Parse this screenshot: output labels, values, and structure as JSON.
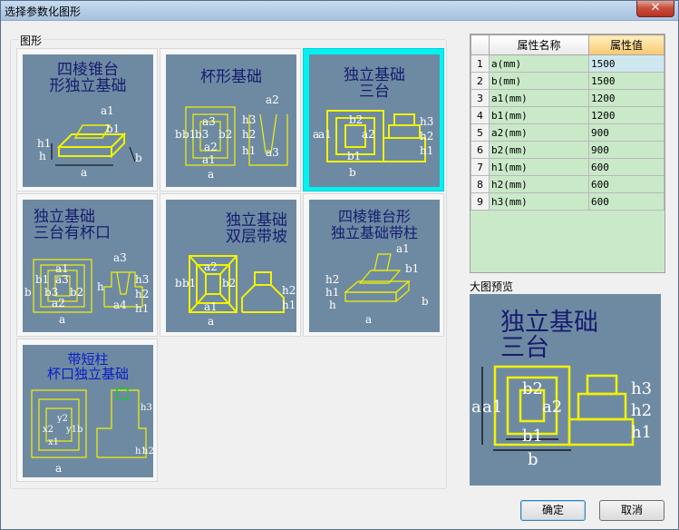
{
  "window": {
    "title": "选择参数化图形",
    "close_glyph": "✕"
  },
  "gallery": {
    "label": "图形",
    "items": [
      {
        "title": "四棱锥台\n形独立基础",
        "labels": [
          "a1",
          "b1",
          "h1",
          "h",
          "a",
          "b"
        ]
      },
      {
        "title": "杯形基础",
        "labels": [
          "a2",
          "b3",
          "h3",
          "a3",
          "b2",
          "h2",
          "b",
          "b1",
          "a2",
          "a1",
          "h1",
          "a3",
          "a"
        ]
      },
      {
        "title": "独立基础\n三台",
        "labels": [
          "b2",
          "a2",
          "b1",
          "a1",
          "a",
          "b",
          "h3",
          "h2",
          "h1"
        ]
      },
      {
        "title": "独立基础\n三台有杯口",
        "labels": [
          "a3",
          "a1",
          "b1",
          "a3",
          "b",
          "b3",
          "b2",
          "a2",
          "a",
          "h",
          "a4",
          "h3",
          "h2",
          "h1"
        ]
      },
      {
        "title": "独立基础\n双层带坡",
        "labels": [
          "a2",
          "b",
          "b1",
          "b2",
          "a1",
          "a",
          "h2",
          "h1"
        ]
      },
      {
        "title": "四棱锥台形\n独立基础带柱",
        "labels": [
          "a1",
          "b1",
          "h2",
          "h1",
          "h",
          "b",
          "a"
        ]
      },
      {
        "title": "带短柱\n杯口独立基础",
        "labels": [
          "x2",
          "y2",
          "x1",
          "y1",
          "b",
          "a",
          "h3",
          "h1",
          "h2"
        ]
      }
    ]
  },
  "properties": {
    "headers": [
      "属性名称",
      "属性值"
    ],
    "rows": [
      {
        "n": "1",
        "name": "a(mm)",
        "value": "1500"
      },
      {
        "n": "2",
        "name": "b(mm)",
        "value": "1500"
      },
      {
        "n": "3",
        "name": "a1(mm)",
        "value": "1200"
      },
      {
        "n": "4",
        "name": "b1(mm)",
        "value": "1200"
      },
      {
        "n": "5",
        "name": "a2(mm)",
        "value": "900"
      },
      {
        "n": "6",
        "name": "b2(mm)",
        "value": "900"
      },
      {
        "n": "7",
        "name": "h1(mm)",
        "value": "600"
      },
      {
        "n": "8",
        "name": "h2(mm)",
        "value": "600"
      },
      {
        "n": "9",
        "name": "h3(mm)",
        "value": "600"
      }
    ]
  },
  "preview": {
    "label": "大图预览",
    "title": "独立基础\n三台",
    "labels": [
      "b2",
      "a2",
      "a1",
      "a",
      "b1",
      "b",
      "h3",
      "h2",
      "h1"
    ]
  },
  "buttons": {
    "ok": "确定",
    "cancel": "取消"
  },
  "colors": {
    "drawing_bg": "#6e8aa3",
    "outline": "#f2f200",
    "selection": "#00f2f2",
    "title_text": "#161c6e"
  }
}
